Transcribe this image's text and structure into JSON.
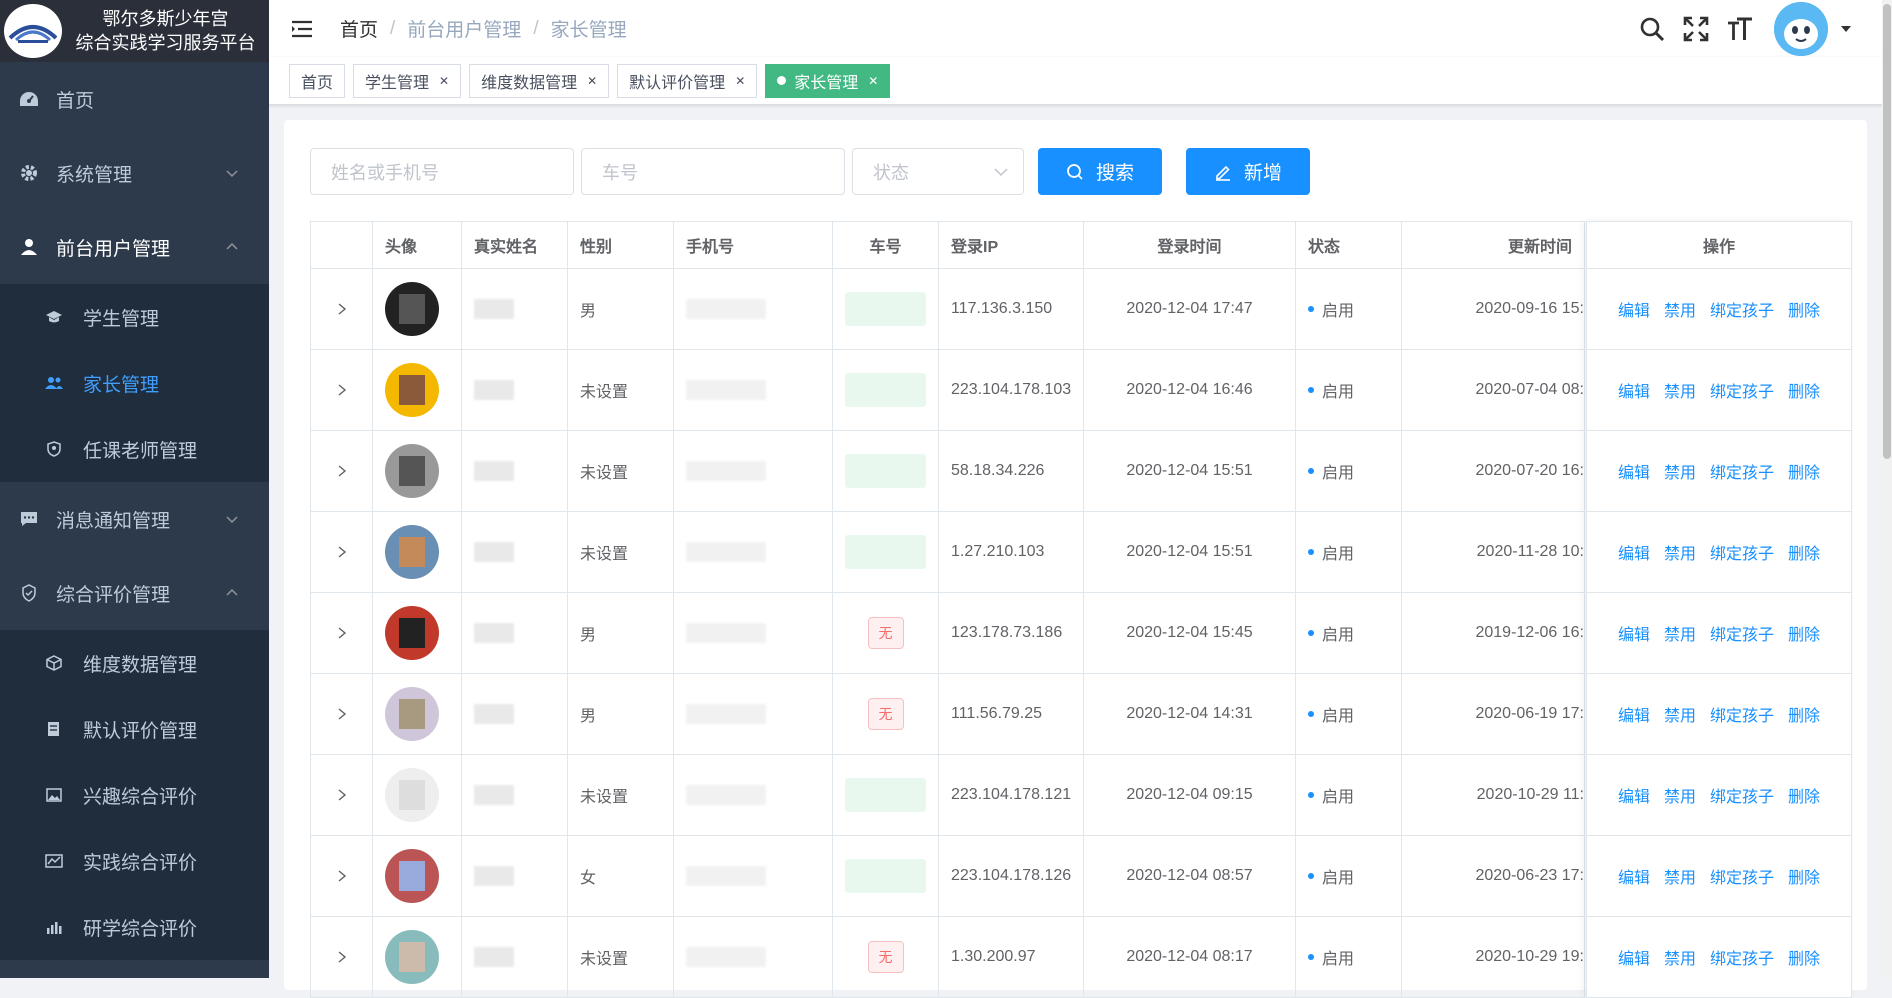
{
  "sidebar": {
    "title_line1": "鄂尔多斯少年宫",
    "title_line2": "综合实践学习服务平台",
    "items": [
      {
        "label": "首页",
        "icon": "dashboard-icon"
      },
      {
        "label": "系统管理",
        "icon": "gear-icon"
      },
      {
        "label": "前台用户管理",
        "icon": "user-icon"
      },
      {
        "label": "消息通知管理",
        "icon": "message-icon"
      },
      {
        "label": "综合评价管理",
        "icon": "evaluation-icon"
      }
    ],
    "user_sub": [
      {
        "label": "学生管理"
      },
      {
        "label": "家长管理"
      },
      {
        "label": "任课老师管理"
      }
    ],
    "eval_sub": [
      {
        "label": "维度数据管理"
      },
      {
        "label": "默认评价管理"
      },
      {
        "label": "兴趣综合评价"
      },
      {
        "label": "实践综合评价"
      },
      {
        "label": "研学综合评价"
      }
    ],
    "colors": {
      "bg": "#2d3a4b",
      "active": "#409eff"
    }
  },
  "breadcrumb": {
    "home": "首页",
    "level1": "前台用户管理",
    "level2": "家长管理"
  },
  "tags": [
    "首页",
    "学生管理",
    "维度数据管理",
    "默认评价管理",
    "家长管理"
  ],
  "filters": {
    "name_placeholder": "姓名或手机号",
    "car_placeholder": "车号",
    "status_placeholder": "状态",
    "search_label": "搜索",
    "add_label": "新增"
  },
  "table": {
    "headers": [
      "头像",
      "真实姓名",
      "性别",
      "手机号",
      "车号",
      "登录IP",
      "登录时间",
      "状态",
      "更新时间",
      "操作"
    ],
    "rows": [
      {
        "gender": "男",
        "car": "",
        "ip": "117.136.3.150",
        "login": "2020-12-04 17:47",
        "status": "启用",
        "updated": "2020-09-16 15:"
      },
      {
        "gender": "未设置",
        "car": "",
        "ip": "223.104.178.103",
        "login": "2020-12-04 16:46",
        "status": "启用",
        "updated": "2020-07-04 08:"
      },
      {
        "gender": "未设置",
        "car": "",
        "ip": "58.18.34.226",
        "login": "2020-12-04 15:51",
        "status": "启用",
        "updated": "2020-07-20 16:"
      },
      {
        "gender": "未设置",
        "car": "",
        "ip": "1.27.210.103",
        "login": "2020-12-04 15:51",
        "status": "启用",
        "updated": "2020-11-28 10:"
      },
      {
        "gender": "男",
        "car": "无",
        "ip": "123.178.73.186",
        "login": "2020-12-04 15:45",
        "status": "启用",
        "updated": "2019-12-06 16:"
      },
      {
        "gender": "男",
        "car": "无",
        "ip": "111.56.79.25",
        "login": "2020-12-04 14:31",
        "status": "启用",
        "updated": "2020-06-19 17:"
      },
      {
        "gender": "未设置",
        "car": "",
        "ip": "223.104.178.121",
        "login": "2020-12-04 09:15",
        "status": "启用",
        "updated": "2020-10-29 11:"
      },
      {
        "gender": "女",
        "car": "",
        "ip": "223.104.178.126",
        "login": "2020-12-04 08:57",
        "status": "启用",
        "updated": "2020-06-23 17:"
      },
      {
        "gender": "未设置",
        "car": "无",
        "ip": "1.30.200.97",
        "login": "2020-12-04 08:17",
        "status": "启用",
        "updated": "2020-10-29 19:"
      }
    ],
    "actions": [
      "编辑",
      "禁用",
      "绑定孩子",
      "删除"
    ]
  },
  "colors": {
    "primary": "#1890ff",
    "tag_active": "#42b983",
    "danger": "#f56c6c"
  }
}
